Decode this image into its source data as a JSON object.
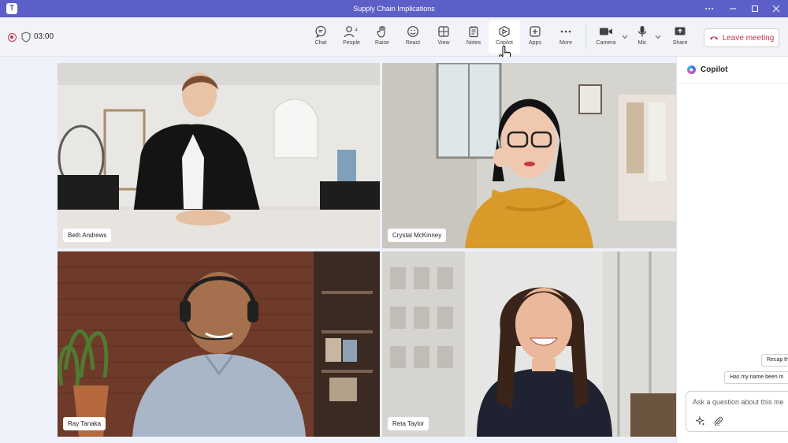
{
  "window": {
    "title": "Supply Chain Implications",
    "app_icon": "T"
  },
  "meeting": {
    "timer": "03:00",
    "people_count": "4"
  },
  "toolbar": {
    "chat": "Chat",
    "people": "People",
    "raise": "Raise",
    "react": "React",
    "view": "View",
    "notes": "Notes",
    "copilot": "Copilot",
    "apps": "Apps",
    "more": "More",
    "camera": "Camera",
    "mic": "Mic",
    "share": "Share",
    "leave": "Leave meeting"
  },
  "participants": [
    {
      "name": "Beth Andrews"
    },
    {
      "name": "Crystal McKinney"
    },
    {
      "name": "Ray Tanaka"
    },
    {
      "name": "Reta Taylor"
    }
  ],
  "copilot_pane": {
    "title": "Copilot",
    "suggestions": [
      "Recap th",
      "Has my name been m"
    ],
    "input_placeholder": "Ask a question about this me"
  },
  "colors": {
    "accent": "#5b5fc7",
    "danger": "#c4314b",
    "toolbar_bg": "#f1f3f9"
  }
}
